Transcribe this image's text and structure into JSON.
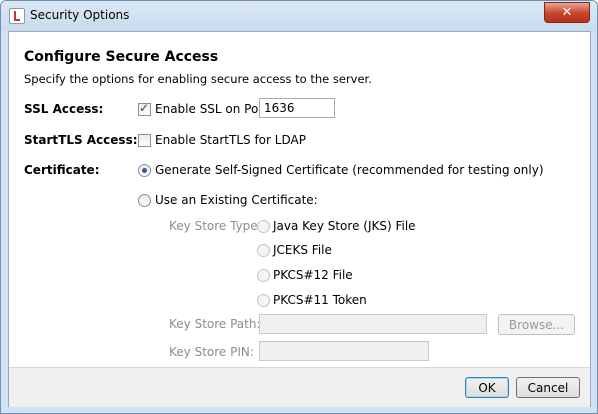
{
  "window": {
    "title": "Security Options",
    "close_glyph": "✕"
  },
  "header": {
    "title": "Configure Secure Access",
    "subtitle": "Specify the options for enabling secure access to the server."
  },
  "ssl": {
    "label": "SSL Access:",
    "checkbox_label": "Enable SSL on Port:",
    "checked": true,
    "port_value": "1636"
  },
  "starttls": {
    "label": "StartTLS Access:",
    "checkbox_label": "Enable StartTLS for LDAP",
    "checked": false
  },
  "certificate": {
    "label": "Certificate:",
    "option_self_signed": "Generate Self-Signed Certificate (recommended for testing only)",
    "option_existing": "Use an Existing Certificate:",
    "selected": "self_signed"
  },
  "keystore": {
    "type_label": "Key Store Type:",
    "types": [
      "Java Key Store (JKS) File",
      "JCEKS File",
      "PKCS#12 File",
      "PKCS#11 Token"
    ],
    "path_label": "Key Store Path:",
    "path_value": "",
    "browse_label": "Browse...",
    "pin_label": "Key Store PIN:",
    "pin_value": ""
  },
  "footer": {
    "ok_label": "OK",
    "cancel_label": "Cancel"
  },
  "icons": [
    "app-icon",
    "close-icon"
  ]
}
